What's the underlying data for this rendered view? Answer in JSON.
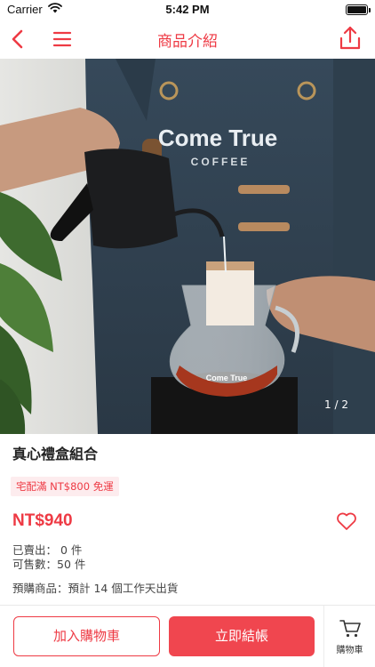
{
  "status_bar": {
    "carrier": "Carrier",
    "time": "5:42 PM"
  },
  "nav": {
    "title": "商品介紹",
    "accent_color": "#ee3a44"
  },
  "gallery": {
    "counter": "1 / 2",
    "apron_logo_line1": "Come True",
    "apron_logo_line2": "COFFEE",
    "cup_logo": "Come True"
  },
  "product": {
    "name": "真心禮盒組合",
    "promo": "宅配滿 NT$800 免運",
    "price": "NT$940",
    "sold": "已賣出： 0 件",
    "stock": "可售數：50 件",
    "preorder": "預購商品：預計 14 個工作天出貨"
  },
  "actions": {
    "add_to_cart": "加入購物車",
    "checkout": "立即結帳",
    "cart_tab": "購物車"
  },
  "icons": {
    "back": "chevron-left-icon",
    "menu": "hamburger-menu-icon",
    "share": "share-icon",
    "favorite": "heart-outline-icon",
    "cart": "cart-icon",
    "wifi": "wifi-icon",
    "battery": "battery-icon"
  }
}
